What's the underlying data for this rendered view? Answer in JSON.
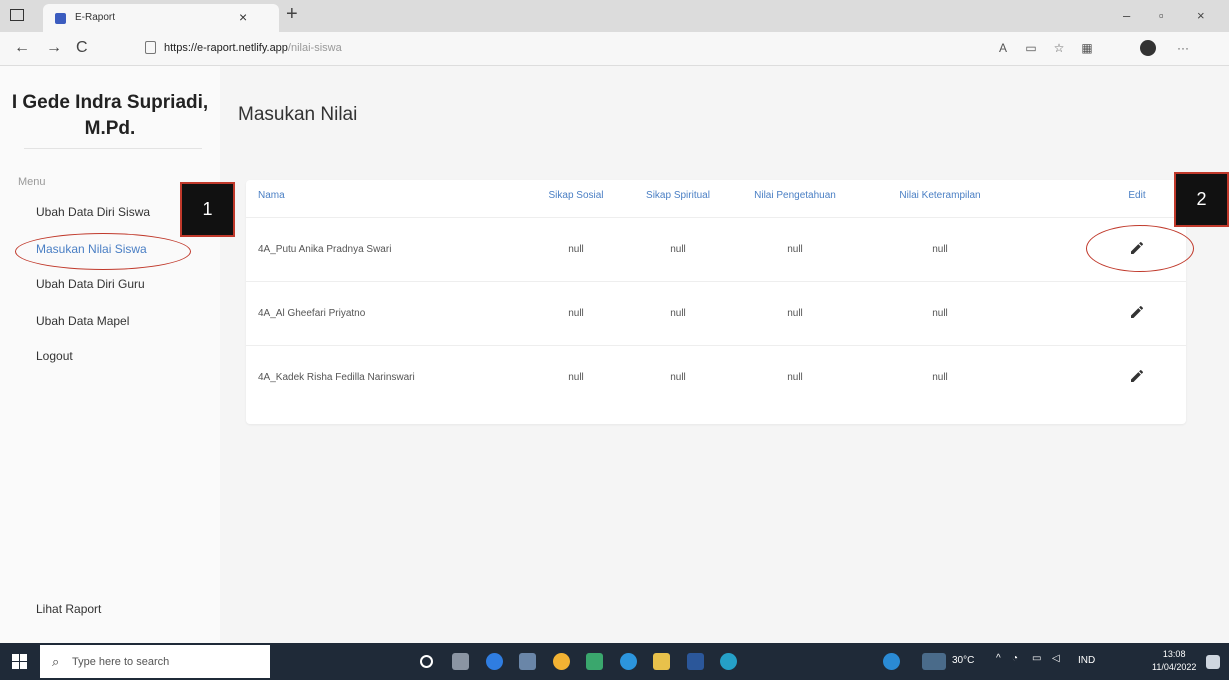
{
  "browser": {
    "tab_title": "E-Raport",
    "tab_close": "×",
    "new_tab": "+",
    "url_host": "https://e-raport.netlify.app",
    "url_path": "/nilai-siswa",
    "nav": {
      "back": "←",
      "forward": "→",
      "reload": "C"
    },
    "window": {
      "minimize": "–",
      "maximize": "▫",
      "close": "×"
    },
    "more": "···"
  },
  "sidebar": {
    "user_name": "I Gede Indra Supriadi, M.Pd.",
    "menu_label": "Menu",
    "items": [
      {
        "label": "Ubah Data Diri Siswa"
      },
      {
        "label": "Masukan Nilai Siswa",
        "active": true
      },
      {
        "label": "Ubah Data Diri Guru"
      },
      {
        "label": "Ubah Data Mapel"
      },
      {
        "label": "Logout"
      }
    ],
    "footer_link": "Lihat Raport"
  },
  "main": {
    "title": "Masukan Nilai",
    "table": {
      "headers": [
        "Nama",
        "Sikap Sosial",
        "Sikap Spiritual",
        "Nilai Pengetahuan",
        "Nilai Keterampilan",
        "Edit"
      ],
      "rows": [
        [
          "4A_Putu Anika Pradnya Swari",
          "null",
          "null",
          "null",
          "null"
        ],
        [
          "4A_Al Gheefari Priyatno",
          "null",
          "null",
          "null",
          "null"
        ],
        [
          "4A_Kadek Risha Fedilla Narinswari",
          "null",
          "null",
          "null",
          "null"
        ]
      ]
    }
  },
  "annotations": {
    "box1": "1",
    "box2": "2"
  },
  "taskbar": {
    "search_placeholder": "Type here to search",
    "temperature": "30°C",
    "language": "IND",
    "time": "13:08",
    "date": "11/04/2022"
  },
  "colors": {
    "accent": "#4a7fc4",
    "annotation": "#c0392b",
    "taskbar": "#1f2a38"
  }
}
